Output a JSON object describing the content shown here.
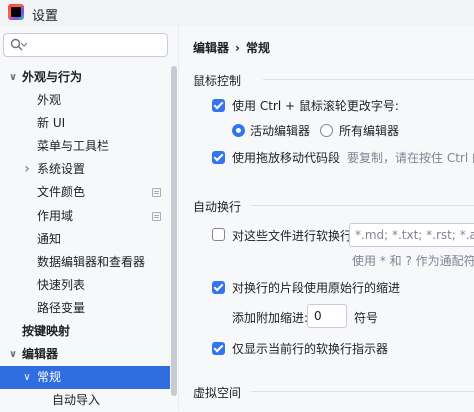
{
  "window": {
    "title": "设置"
  },
  "search": {
    "placeholder": ""
  },
  "sidebar": {
    "items": [
      {
        "label": "外观与行为",
        "level": 0,
        "expand": "down",
        "bold": true,
        "selected": false,
        "badge": false
      },
      {
        "label": "外观",
        "level": 1,
        "expand": "",
        "bold": false,
        "selected": false,
        "badge": false
      },
      {
        "label": "新 UI",
        "level": 1,
        "expand": "",
        "bold": false,
        "selected": false,
        "badge": false
      },
      {
        "label": "菜单与工具栏",
        "level": 1,
        "expand": "",
        "bold": false,
        "selected": false,
        "badge": false
      },
      {
        "label": "系统设置",
        "level": 1,
        "expand": "right",
        "bold": false,
        "selected": false,
        "badge": false
      },
      {
        "label": "文件颜色",
        "level": 1,
        "expand": "",
        "bold": false,
        "selected": false,
        "badge": true
      },
      {
        "label": "作用域",
        "level": 1,
        "expand": "",
        "bold": false,
        "selected": false,
        "badge": true
      },
      {
        "label": "通知",
        "level": 1,
        "expand": "",
        "bold": false,
        "selected": false,
        "badge": false
      },
      {
        "label": "数据编辑器和查看器",
        "level": 1,
        "expand": "",
        "bold": false,
        "selected": false,
        "badge": false
      },
      {
        "label": "快速列表",
        "level": 1,
        "expand": "",
        "bold": false,
        "selected": false,
        "badge": false
      },
      {
        "label": "路径变量",
        "level": 1,
        "expand": "",
        "bold": false,
        "selected": false,
        "badge": false
      },
      {
        "label": "按键映射",
        "level": 0,
        "expand": "",
        "bold": true,
        "selected": false,
        "badge": false
      },
      {
        "label": "编辑器",
        "level": 0,
        "expand": "down",
        "bold": true,
        "selected": false,
        "badge": false
      },
      {
        "label": "常规",
        "level": 1,
        "expand": "down",
        "bold": false,
        "selected": true,
        "badge": false
      },
      {
        "label": "自动导入",
        "level": 2,
        "expand": "",
        "bold": false,
        "selected": false,
        "badge": false
      }
    ]
  },
  "breadcrumb": {
    "parent": "编辑器",
    "separator": "›",
    "current": "常规"
  },
  "mouse_control": {
    "title": "鼠标控制",
    "ctrl_wheel_zoom": {
      "label": "使用 Ctrl + 鼠标滚轮更改字号:",
      "checked": true
    },
    "zoom_active_editor": {
      "label": "活动编辑器",
      "selected": true
    },
    "zoom_all_editors": {
      "label": "所有编辑器",
      "selected": false
    },
    "drag_move_code": {
      "label": "使用拖放移动代码段",
      "checked": true
    },
    "drag_hint": "要复制，请在按住 Ctrl 的"
  },
  "soft_wraps": {
    "title": "自动换行",
    "wrap_files": {
      "label": "对这些文件进行软换行:",
      "checked": false
    },
    "file_patterns": "*.md; *.txt; *.rst; *.adoc",
    "patterns_hint": "使用 * 和 ? 作为通配符,",
    "use_original_indent": {
      "label": "对换行的片段使用原始行的缩进",
      "checked": true
    },
    "extra_indent": {
      "label": "添加附加缩进:",
      "value": "0",
      "unit": "符号"
    },
    "show_wrap_indicator": {
      "label": "仅显示当前行的软换行指示器",
      "checked": true
    }
  },
  "virtual_space": {
    "title": "虚拟空间"
  },
  "colors": {
    "accent": "#3574f0",
    "selection": "#2f6ee1"
  }
}
